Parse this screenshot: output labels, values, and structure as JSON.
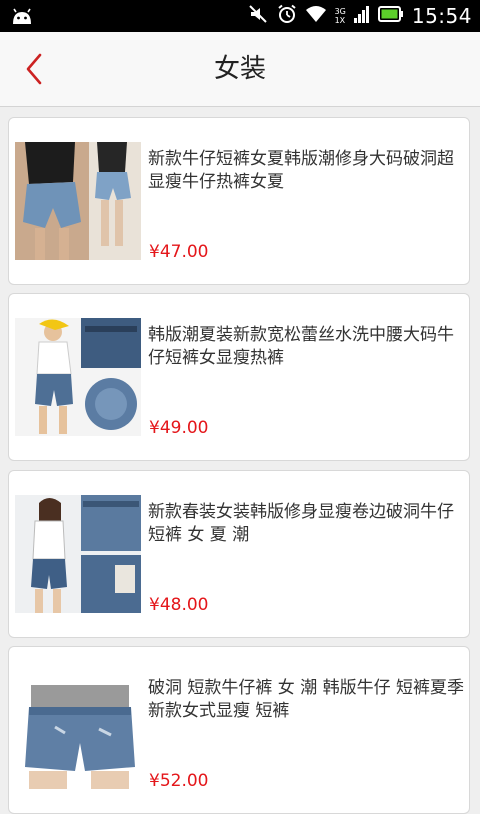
{
  "status_bar": {
    "time": "15:54",
    "network_top": "3G",
    "network_bottom": "1X",
    "icons": [
      "android-icon",
      "mute-icon",
      "alarm-icon",
      "wifi-icon",
      "signal-icon",
      "battery-icon"
    ]
  },
  "header": {
    "title": "女装",
    "back_icon": "chevron-left-icon"
  },
  "colors": {
    "accent": "#e4161a",
    "back_arrow": "#cc2222"
  },
  "products": [
    {
      "name": "新款牛仔短裤女夏韩版潮修身大码破洞超显瘦牛仔热裤女夏",
      "price": "¥47.00"
    },
    {
      "name": "韩版潮夏装新款宽松蕾丝水洗中腰大码牛仔短裤女显瘦热裤",
      "price": "¥49.00"
    },
    {
      "name": "新款春装女装韩版修身显瘦卷边破洞牛仔短裤 女 夏 潮",
      "price": "¥48.00"
    },
    {
      "name": "破洞 短款牛仔裤 女 潮 韩版牛仔 短裤夏季新款女式显瘦 短裤",
      "price": "¥52.00"
    }
  ]
}
